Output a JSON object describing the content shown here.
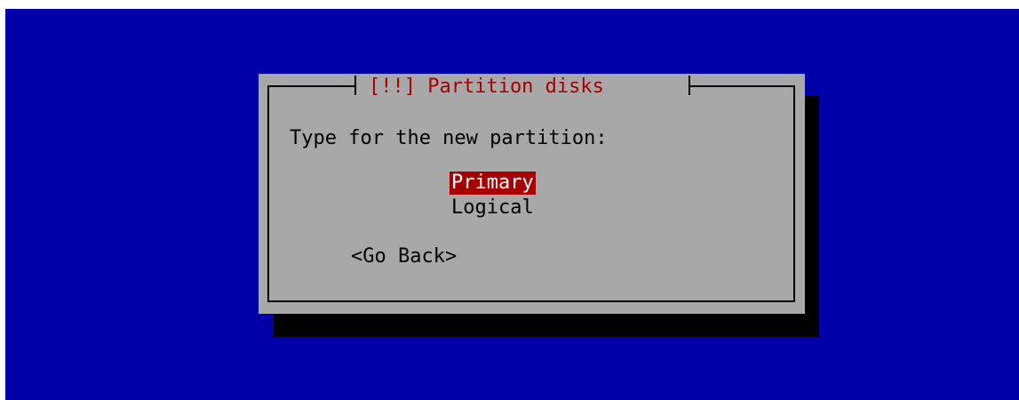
{
  "colors": {
    "screen_background": "#0000a8",
    "dialog_background": "#a8a8a8",
    "title_text": "#a80000",
    "selected_background": "#a80000",
    "selected_text": "#ffffff",
    "shadow": "#000000"
  },
  "dialog": {
    "title": "[!!] Partition disks",
    "prompt": "Type for the new partition:",
    "options": [
      {
        "label": "Primary",
        "selected": true
      },
      {
        "label": "Logical",
        "selected": false
      }
    ],
    "go_back_label": "<Go Back>"
  }
}
